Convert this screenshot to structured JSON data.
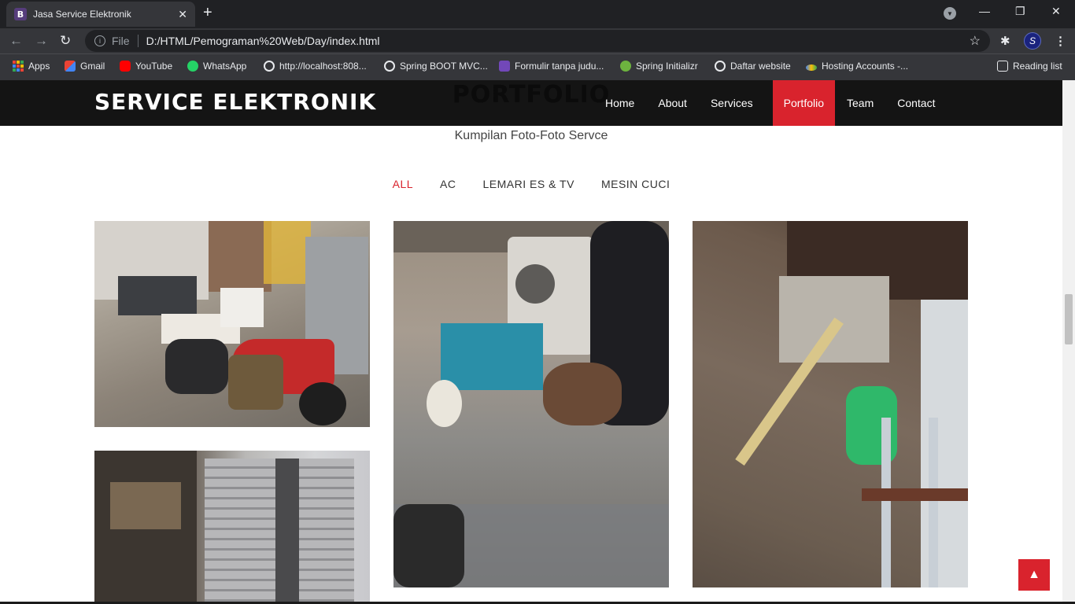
{
  "browser": {
    "tab_title": "Jasa Service Elektronik",
    "tab_favicon": "B",
    "address_scheme": "File",
    "address_url": "D:/HTML/Pemograman%20Web/Day/index.html",
    "bookmarks": [
      {
        "label": "Apps",
        "icon": "apps-grid-icon"
      },
      {
        "label": "Gmail",
        "icon": "gmail-icon"
      },
      {
        "label": "YouTube",
        "icon": "youtube-icon"
      },
      {
        "label": "WhatsApp",
        "icon": "whatsapp-icon"
      },
      {
        "label": "http://localhost:808...",
        "icon": "globe-icon"
      },
      {
        "label": "Spring BOOT MVC...",
        "icon": "globe-icon"
      },
      {
        "label": "Formulir tanpa judu...",
        "icon": "forms-icon"
      },
      {
        "label": "Spring Initializr",
        "icon": "spring-icon"
      },
      {
        "label": "Daftar website",
        "icon": "globe-icon"
      },
      {
        "label": "Hosting Accounts -...",
        "icon": "hosting-icon"
      }
    ],
    "reading_list": "Reading list",
    "avatar_letter": "S"
  },
  "site": {
    "logo": "SERVICE ELEKTRONIK",
    "nav": [
      "Home",
      "About",
      "Services",
      "Portfolio",
      "Team",
      "Contact"
    ],
    "active_nav": "Portfolio",
    "section_title": "PORTFOLIO",
    "section_subtitle": "Kumpilan Foto-Foto Servce",
    "filters": [
      "ALL",
      "AC",
      "LEMARI ES & TV",
      "MESIN CUCI"
    ],
    "active_filter": "ALL",
    "accent_color": "#d9232d",
    "gallery": [
      {
        "desc": "motorcycle-carrying-ac-unit-photo"
      },
      {
        "desc": "washing-machine-parts-on-floor-photo"
      },
      {
        "desc": "outdoor-ac-unit-repair-on-wall-photo"
      },
      {
        "desc": "refrigerator-condenser-coil-photo"
      }
    ],
    "back_to_top_icon": "chevron-up-icon"
  }
}
